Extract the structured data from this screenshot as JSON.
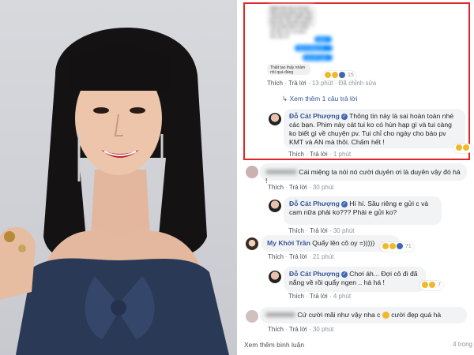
{
  "fb": {
    "screenshot_messages": [
      "Nghe bảo bà có là giọ trên trong phim này nên chối lên luôn. KMT nghe theo bà. Còn Ah cũng k còn gì để mất vì cũng đã đính hôn với Alex bên Mỹ rồi",
      "quán",
      "vậy là đúng rồi chứ nhau",
      "và cả P quá ghê",
      "Thiệt tao thấy nhảm nhí quá đáng"
    ],
    "top_reaction_count": "15",
    "top_actions": {
      "like": "Thích",
      "reply": "Trả lời",
      "time": "13 phút",
      "edited": "Đã chỉnh sửa"
    },
    "see_more_replies": "Xem thêm 1 câu trả lời",
    "comments": [
      {
        "name": "Đỗ Cát Phượng",
        "text": "Thông tin này là sai hoàn toàn nhé các bạn. Phim này cát tui ko có hùn hạp gì và tui càng ko biết gì về chuyện pv. Tui chỉ cho ngày cho báo pv KMT và AN mà thôi. Chấm hết !",
        "like": "Thích",
        "reply": "Trả lời",
        "time": "1 phút"
      },
      {
        "name": "",
        "text": "Cái miệng ta nói nó cười duyên ơi là duyên vậy đó há !",
        "like": "Thích",
        "reply": "Trả lời",
        "time": "30 phút"
      },
      {
        "name": "Đỗ Cát Phượng",
        "text": "Hí hí. Sầu riêng e gửi c và cam nữa phải ko??? Phải e gửi ko?",
        "like": "Thích",
        "reply": "Trả lời",
        "time": "30 phút"
      },
      {
        "name": "My Khởi Trần",
        "text": "Quẩy lên cô oy =)))))",
        "like": "Thích",
        "reply": "Trả lời",
        "time": "21 phút",
        "reaction_count": "71"
      },
      {
        "name": "Đỗ Cát Phượng",
        "text": "Chơi áh... Đợi cô đi đã nắng về rồi quẩy ngen .. há há !",
        "like": "Thích",
        "reply": "Trả lời",
        "time": "4 phút",
        "reaction_count": "7"
      },
      {
        "name": "",
        "text_before": "Cứ cười mãi như vậy nha c",
        "text_after": "cười đẹp quá hà",
        "like": "Thích",
        "reply": "Trả lời",
        "time": "30 phút"
      }
    ],
    "footer": {
      "see_more": "Xem thêm bình luận",
      "count": "4 trong"
    }
  },
  "colors": {
    "accent": "#385898",
    "highlight_border": "#e0262b",
    "bubble": "#f2f3f5"
  }
}
